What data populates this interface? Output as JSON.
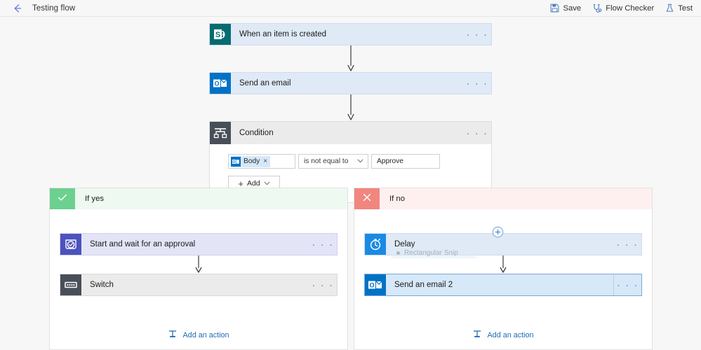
{
  "topbar": {
    "back_icon": "back-arrow-icon",
    "title": "Testing flow",
    "commands": [
      {
        "label": "Save",
        "icon": "save-icon"
      },
      {
        "label": "Flow Checker",
        "icon": "stethoscope-icon"
      },
      {
        "label": "Test",
        "icon": "flask-icon"
      }
    ]
  },
  "flow": {
    "trigger": {
      "title": "When an item is created",
      "icon": "sharepoint-icon",
      "icon_color": "#036C70",
      "ellipsis": "· · ·"
    },
    "action1": {
      "title": "Send an email",
      "icon": "outlook-icon",
      "icon_color": "#0072C6",
      "ellipsis": "· · ·"
    },
    "condition": {
      "title": "Condition",
      "icon": "condition-branch-icon",
      "icon_color": "#484f58",
      "ellipsis": "· · ·",
      "row": {
        "token_label": "Body",
        "token_icon": "outlook-icon",
        "token_remove": "×",
        "operator": "is not equal to",
        "operator_chevron": "⌄",
        "value": "Approve"
      },
      "add_button": {
        "label": "Add",
        "plus": "+",
        "chevron": "⌄"
      }
    }
  },
  "branches": {
    "yes": {
      "title": "If yes",
      "badge_icon": "checkmark-icon",
      "badge_color": "#6cd08f",
      "band_color": "#eef9f1",
      "nodes": [
        {
          "title": "Start and wait for an approval",
          "icon": "approval-icon",
          "icon_color": "#4b53bc",
          "body_color": "#e4e4f7",
          "ellipsis": "· · ·",
          "selected": false
        },
        {
          "title": "Switch",
          "icon": "switch-icon",
          "icon_color": "#484f58",
          "body_color": "#ebebeb",
          "ellipsis": "· · ·",
          "selected": false
        }
      ],
      "add_action": {
        "label": "Add an action",
        "icon": "add-action-icon"
      }
    },
    "no": {
      "title": "If no",
      "badge_icon": "close-x-icon",
      "badge_color": "#f1867e",
      "band_color": "#fdf0ef",
      "plus_button_icon": "plus-circle-icon",
      "ghost_overlay": {
        "label": "Rectangular Snip",
        "icon": "snip-dot-icon"
      },
      "nodes": [
        {
          "title": "Delay",
          "icon": "delay-stopwatch-icon",
          "icon_color": "#1a8ae5",
          "body_color": "#dfeaf6",
          "ellipsis": "· · ·",
          "selected": false
        },
        {
          "title": "Send an email 2",
          "icon": "outlook-icon",
          "icon_color": "#0072C6",
          "body_color": "#d7e8f8",
          "ellipsis": "· · ·",
          "selected": true
        }
      ],
      "add_action": {
        "label": "Add an action",
        "icon": "add-action-icon"
      }
    }
  }
}
